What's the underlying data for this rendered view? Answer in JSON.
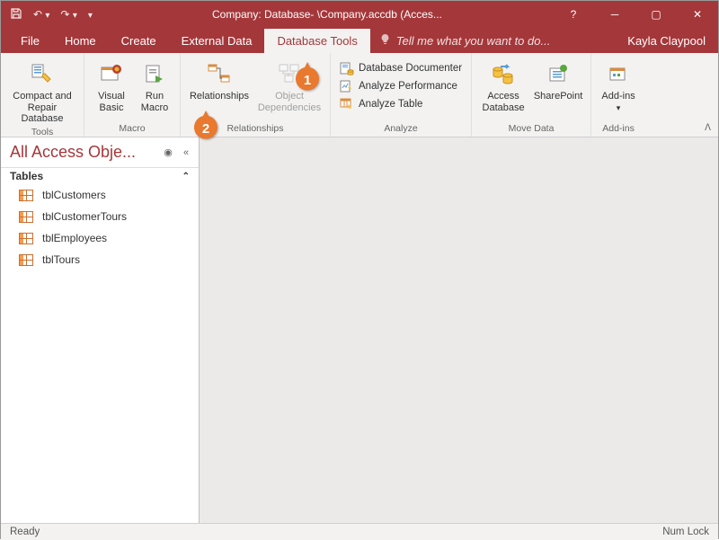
{
  "titlebar": {
    "title": "Company: Database- \\Company.accdb (Acces..."
  },
  "tabs": {
    "file": "File",
    "home": "Home",
    "create": "Create",
    "external": "External Data",
    "dbtools": "Database Tools",
    "tell": "Tell me what you want to do...",
    "user": "Kayla Claypool"
  },
  "ribbon": {
    "tools": {
      "compact": "Compact and Repair Database",
      "label": "Tools"
    },
    "macro": {
      "vb": "Visual Basic",
      "run": "Run Macro",
      "label": "Macro"
    },
    "rel": {
      "relationships": "Relationships",
      "deps": "Object Dependencies",
      "label": "Relationships"
    },
    "analyze": {
      "doc": "Database Documenter",
      "perf": "Analyze Performance",
      "tbl": "Analyze Table",
      "label": "Analyze"
    },
    "move": {
      "access": "Access Database",
      "sp": "SharePoint",
      "label": "Move Data"
    },
    "addins": {
      "addins": "Add-ins",
      "label": "Add-ins"
    }
  },
  "nav": {
    "title": "All Access Obje...",
    "section": "Tables",
    "items": [
      "tblCustomers",
      "tblCustomerTours",
      "tblEmployees",
      "tblTours"
    ]
  },
  "status": {
    "left": "Ready",
    "right": "Num Lock"
  },
  "callouts": {
    "c1": "1",
    "c2": "2"
  }
}
